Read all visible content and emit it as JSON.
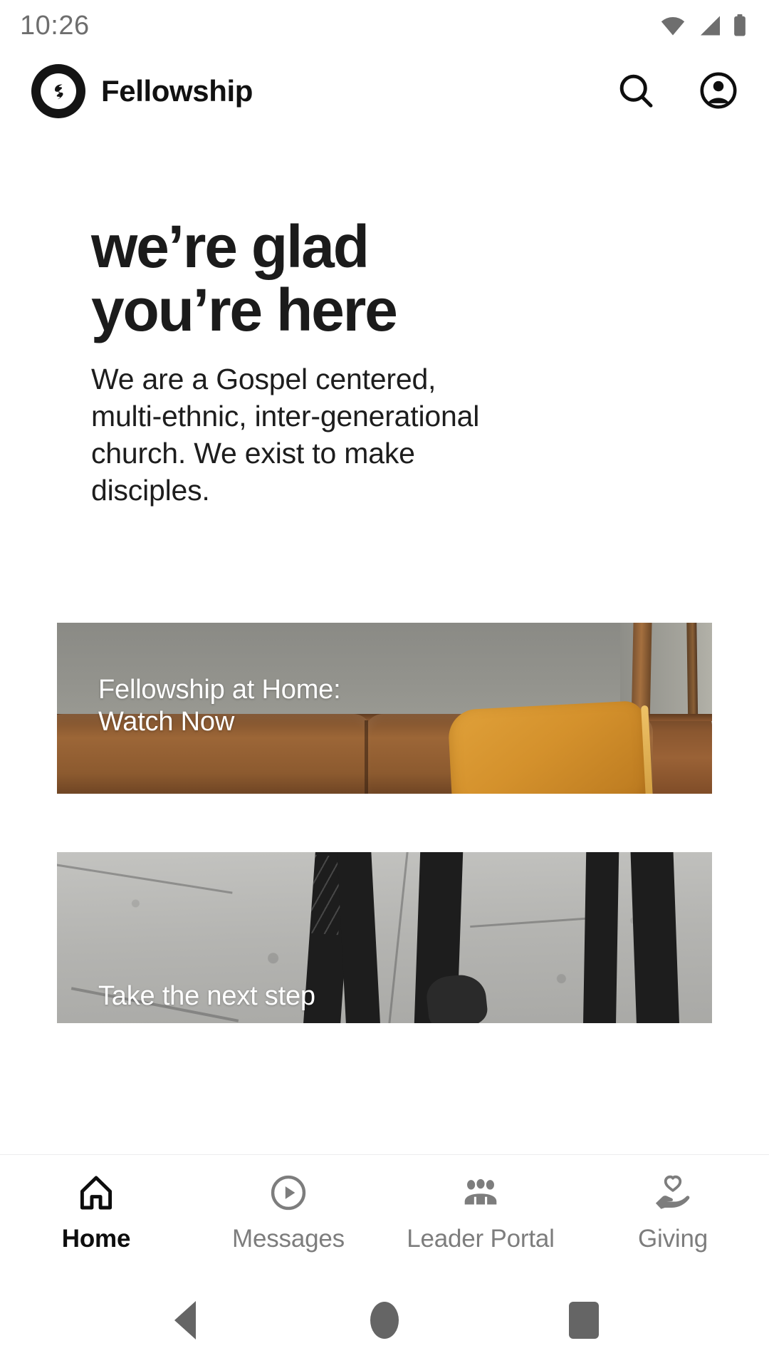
{
  "status_bar": {
    "time": "10:26",
    "icons": [
      "wifi-icon",
      "cellular-signal-icon",
      "battery-icon"
    ]
  },
  "header": {
    "logo_icon": "fellowship-logo-icon",
    "app_name": "Fellowship",
    "search_icon": "search-icon",
    "account_icon": "account-circle-icon"
  },
  "hero": {
    "title_line1": "we’re glad",
    "title_line2": "you’re here",
    "body": "We are a Gospel centered, multi-ethnic, inter-generational church. We exist to make disciples."
  },
  "cards": [
    {
      "caption_line1": "Fellowship at Home:",
      "caption_line2": "Watch Now",
      "image_alt": "brown leather couch with mustard pillow against gray wall"
    },
    {
      "caption_line1": "Take the next step",
      "caption_line2": "",
      "image_alt": "grayscale photo of legs walking on concrete pavement"
    }
  ],
  "tabbar": {
    "items": [
      {
        "label": "Home",
        "icon": "home-icon",
        "active": true
      },
      {
        "label": "Messages",
        "icon": "play-circle-icon",
        "active": false
      },
      {
        "label": "Leader Portal",
        "icon": "people-group-icon",
        "active": false
      },
      {
        "label": "Giving",
        "icon": "hand-heart-icon",
        "active": false
      }
    ]
  },
  "system_nav": {
    "back": "back-triangle-icon",
    "home": "home-circle-icon",
    "recents": "recents-square-icon"
  },
  "colors": {
    "text_primary": "#1b1b1b",
    "text_muted": "#7d7d7d",
    "status_icon": "#6e6e6e",
    "accent_dark": "#141414",
    "card_caption": "#ffffff"
  }
}
